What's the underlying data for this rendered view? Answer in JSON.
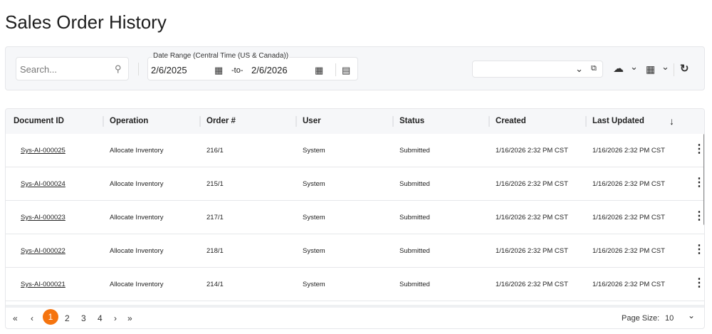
{
  "page": {
    "title": "Sales Order History"
  },
  "toolbar": {
    "search_placeholder": "Search...",
    "date_range": {
      "label": "Date Range (Central Time (US & Canada))",
      "from": "2/6/2025",
      "separator": "-to-",
      "to": "2/6/2026"
    },
    "view_select": {
      "value": ""
    },
    "icons": [
      "search-icon",
      "calendar-icon",
      "calendar-clock-icon",
      "chevron-down-icon",
      "copy-icon",
      "cloud-download-icon",
      "grid-icon",
      "refresh-icon"
    ]
  },
  "table": {
    "columns": [
      "Document ID",
      "Operation",
      "Order #",
      "User",
      "Status",
      "Created",
      "Last Updated"
    ],
    "sort": "descending",
    "rows": [
      [
        "Sys-AI-000025",
        "Allocate Inventory",
        "216/1",
        "System",
        "Submitted",
        "1/16/2026 2:32 PM CST",
        "1/16/2026 2:32 PM CST"
      ],
      [
        "Sys-AI-000024",
        "Allocate Inventory",
        "215/1",
        "System",
        "Submitted",
        "1/16/2026 2:32 PM CST",
        "1/16/2026 2:32 PM CST"
      ],
      [
        "Sys-AI-000023",
        "Allocate Inventory",
        "217/1",
        "System",
        "Submitted",
        "1/16/2026 2:32 PM CST",
        "1/16/2026 2:32 PM CST"
      ],
      [
        "Sys-AI-000022",
        "Allocate Inventory",
        "218/1",
        "System",
        "Submitted",
        "1/16/2026 2:32 PM CST",
        "1/16/2026 2:32 PM CST"
      ],
      [
        "Sys-AI-000021",
        "Allocate Inventory",
        "214/1",
        "System",
        "Submitted",
        "1/16/2026 2:32 PM CST",
        "1/16/2026 2:32 PM CST"
      ]
    ]
  },
  "pagination": {
    "pages": [
      "1",
      "2",
      "3",
      "4"
    ],
    "current": "1",
    "page_size_label": "Page Size:",
    "page_size": "10",
    "accent": "#f5740f"
  }
}
